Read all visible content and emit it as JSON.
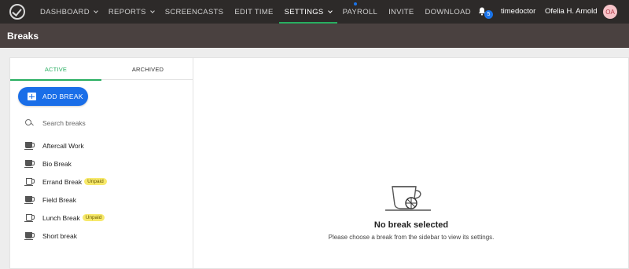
{
  "nav": {
    "items": [
      {
        "label": "DASHBOARD",
        "dropdown": true
      },
      {
        "label": "REPORTS",
        "dropdown": true
      },
      {
        "label": "SCREENCASTS",
        "dropdown": false
      },
      {
        "label": "EDIT TIME",
        "dropdown": false
      },
      {
        "label": "SETTINGS",
        "dropdown": true,
        "active": true
      },
      {
        "label": "PAYROLL",
        "dropdown": false,
        "dot": true
      },
      {
        "label": "INVITE",
        "dropdown": false
      },
      {
        "label": "DOWNLOAD",
        "dropdown": false
      }
    ],
    "notification_count": "5",
    "company": "timedoctor",
    "user_name": "Ofelia H. Arnold",
    "avatar_initials": "OA"
  },
  "page": {
    "title": "Breaks"
  },
  "sidebar": {
    "tabs": {
      "active": "ACTIVE",
      "archived": "ARCHIVED"
    },
    "add_button": "ADD BREAK",
    "search_placeholder": "Search breaks",
    "unpaid_label": "Unpaid",
    "items": [
      {
        "label": "Aftercall Work",
        "unpaid": false
      },
      {
        "label": "Bio Break",
        "unpaid": false
      },
      {
        "label": "Errand Break",
        "unpaid": true
      },
      {
        "label": "Field Break",
        "unpaid": false
      },
      {
        "label": "Lunch Break",
        "unpaid": true
      },
      {
        "label": "Short break",
        "unpaid": false
      }
    ]
  },
  "empty_state": {
    "title": "No break selected",
    "subtitle": "Please choose a break from the sidebar to view its settings."
  },
  "colors": {
    "nav_bg": "#2d2a29",
    "header_bg": "#4a4140",
    "accent_green": "#27ae60",
    "primary_blue": "#1a6ee8",
    "unpaid_yellow": "#f7e96b"
  }
}
